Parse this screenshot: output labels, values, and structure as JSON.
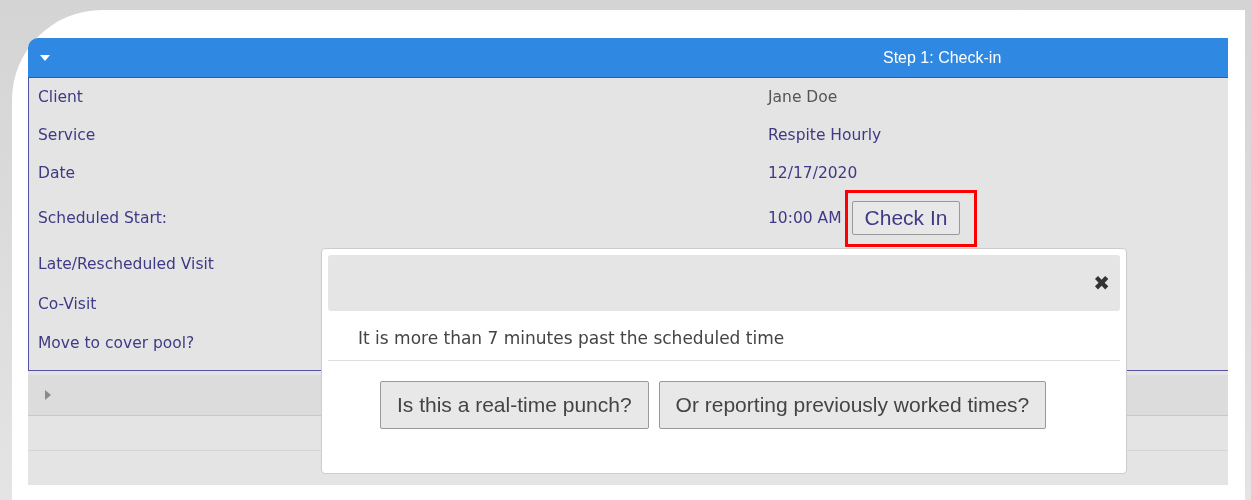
{
  "panel": {
    "title": "Step 1: Check-in",
    "expanded": true
  },
  "rows": [
    {
      "label": "Client",
      "value": "Jane Doe"
    },
    {
      "label": "Service",
      "value": "Respite Hourly"
    },
    {
      "label": "Date",
      "value": "12/17/2020"
    },
    {
      "label": "Scheduled Start:",
      "value": "10:00 AM",
      "button": "Check In",
      "highlighted": true
    },
    {
      "label": "Late/Rescheduled Visit"
    },
    {
      "label": "Co-Visit"
    },
    {
      "label": "Move to cover pool?"
    }
  ],
  "collapsed_section": {
    "expanded": false
  },
  "dialog": {
    "close": "✖",
    "message": "It is more than 7 minutes past the scheduled time",
    "buttons": [
      "Is this a real-time punch?",
      "Or reporting previously worked times?"
    ]
  }
}
